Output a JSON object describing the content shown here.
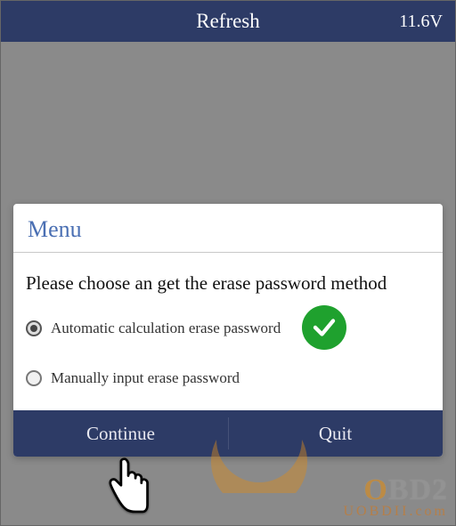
{
  "topbar": {
    "title": "Refresh",
    "voltage": "11.6V"
  },
  "dialog": {
    "title": "Menu",
    "prompt": "Please choose an get the erase password method",
    "options": {
      "auto": "Automatic calculation erase password",
      "manual": "Manually input erase password"
    },
    "buttons": {
      "continue": "Continue",
      "quit": "Quit"
    }
  },
  "watermark": {
    "brand_prefix": "O",
    "brand_rest": "BD2",
    "sub": "UOBDII.com"
  }
}
